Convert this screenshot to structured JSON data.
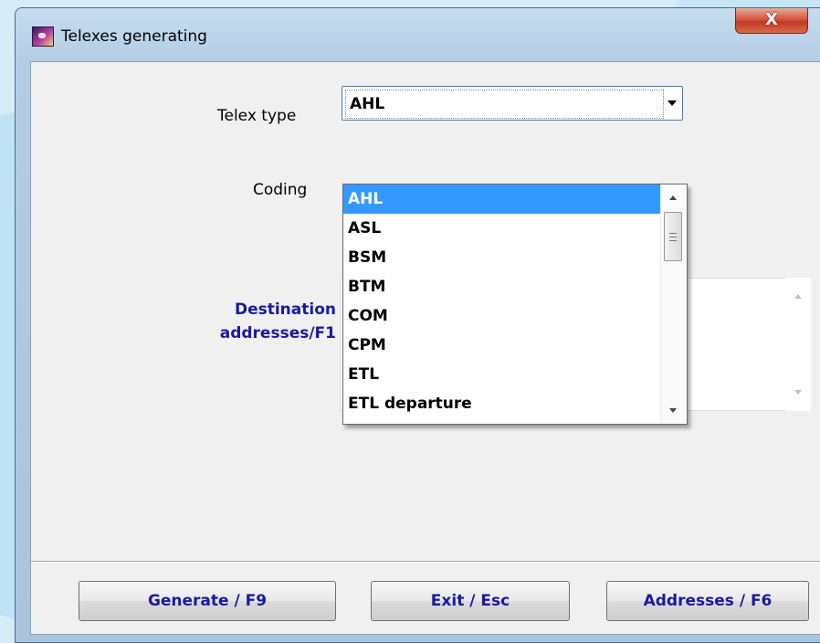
{
  "window": {
    "title": "Telexes generating",
    "close_label": "X"
  },
  "form": {
    "telex_type_label": "Telex type",
    "telex_type_value": "AHL",
    "coding_label": "Coding",
    "destination_label_line1": "Destination",
    "destination_label_line2": "addresses/F1",
    "destination_value": ""
  },
  "dropdown": {
    "items": [
      "AHL",
      "ASL",
      "BSM",
      "BTM",
      "COM",
      "CPM",
      "ETL",
      "ETL departure"
    ],
    "selected": "AHL"
  },
  "buttons": {
    "generate": "Generate / F9",
    "exit": "Exit / Esc",
    "addresses": "Addresses / F6"
  },
  "colors": {
    "selection": "#3399ff",
    "label_blue": "#1a1aa0",
    "close_red": "#c03a22"
  }
}
